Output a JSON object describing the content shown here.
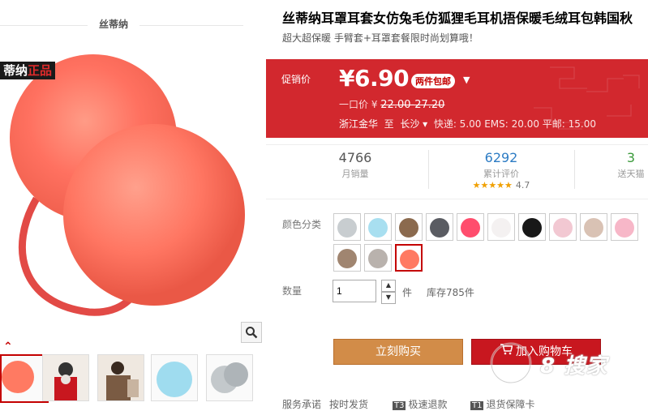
{
  "brand": {
    "name": "丝蒂纳",
    "logo_text_main": "蒂纳",
    "logo_text_accent": "正品"
  },
  "product": {
    "title": "丝蒂纳耳罩耳套女仿兔毛仿狐狸毛耳机捂保暖毛绒耳包韩国秋",
    "subtitle": "超大超保暖 手臂套+耳罩套餐限时尚划算哦！"
  },
  "price": {
    "label": "促销价",
    "amount": "¥6.90",
    "promo_badge": "两件包邮",
    "original_label": "一口价 ¥",
    "original_range": "22.00-27.20",
    "ship_from": "浙江金华",
    "ship_to_word": "至",
    "ship_to": "长沙",
    "ship_fees": "快递: 5.00 EMS: 20.00 平邮: 15.00"
  },
  "stats": [
    {
      "value": "4766",
      "label": "月销量"
    },
    {
      "value": "6292",
      "label": "累计评价",
      "rating": "4.7"
    },
    {
      "value": "3",
      "label": "送天猫"
    }
  ],
  "options": {
    "color_label": "颜色分类",
    "swatches": [
      {
        "name": "gray-fur",
        "color": "#c8cdd0"
      },
      {
        "name": "light-blue-fur",
        "color": "#a8dff0"
      },
      {
        "name": "brown-fur",
        "color": "#8b6a4e"
      },
      {
        "name": "dark-gray-knit",
        "color": "#5a5c62"
      },
      {
        "name": "rose-red-fur",
        "color": "#ff4d6d"
      },
      {
        "name": "white-fur",
        "color": "#f4f1f1"
      },
      {
        "name": "black-fur",
        "color": "#181818"
      },
      {
        "name": "pink-knit",
        "color": "#f2c8d2"
      },
      {
        "name": "model-photo",
        "color": "#d9c2b4"
      },
      {
        "name": "pink-fur",
        "color": "#f7b7c8"
      },
      {
        "name": "coffee-fur",
        "color": "#a08570"
      },
      {
        "name": "smoke-fur",
        "color": "#b9b2ad"
      },
      {
        "name": "orange-fur",
        "color": "#ff7a62"
      }
    ],
    "qty_label": "数量",
    "qty_value": "1",
    "qty_unit": "件",
    "stock": "库存785件"
  },
  "actions": {
    "buy_now": "立刻购买",
    "add_to_cart": "加入购物车"
  },
  "services": {
    "label": "服务承诺",
    "items": [
      "按时发货",
      "极速退款",
      "退货保障卡"
    ],
    "badges": [
      "",
      "T3",
      "T1"
    ]
  },
  "watermark": {
    "text": "8 搜家"
  },
  "colors": {
    "price_red": "#d2282e",
    "buy_orange": "#d28c48",
    "cart_red": "#c8171f",
    "accent_blue": "#2d7cc4"
  }
}
